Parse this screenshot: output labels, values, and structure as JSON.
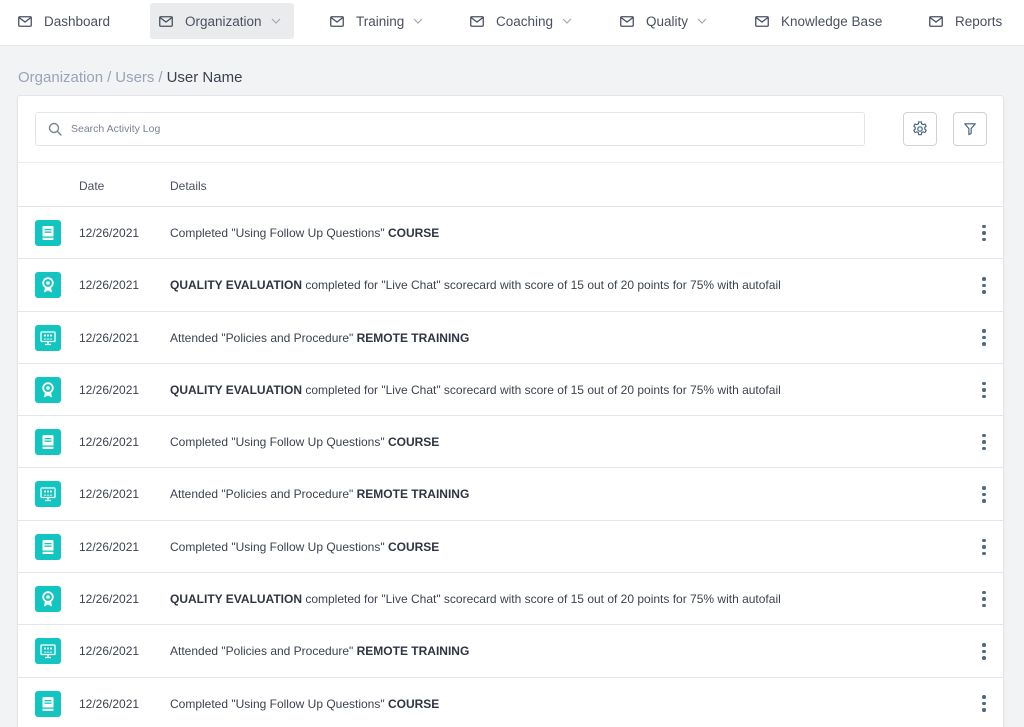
{
  "nav": {
    "items": [
      {
        "label": "Dashboard",
        "dropdown": false,
        "active": false,
        "icon": "mail-icon"
      },
      {
        "label": "Organization",
        "dropdown": true,
        "active": true,
        "icon": "mail-icon"
      },
      {
        "label": "Training",
        "dropdown": true,
        "active": false,
        "icon": "mail-icon"
      },
      {
        "label": "Coaching",
        "dropdown": true,
        "active": false,
        "icon": "mail-icon"
      },
      {
        "label": "Quality",
        "dropdown": true,
        "active": false,
        "icon": "mail-icon"
      },
      {
        "label": "Knowledge Base",
        "dropdown": false,
        "active": false,
        "icon": "mail-icon"
      },
      {
        "label": "Reports",
        "dropdown": false,
        "active": false,
        "icon": "mail-icon"
      }
    ]
  },
  "breadcrumb": {
    "links": [
      "Organization",
      "Users"
    ],
    "separator": "/",
    "current": "User Name"
  },
  "search": {
    "placeholder": "Search Activity Log",
    "value": ""
  },
  "toolbar": {
    "settings_icon": "gear-icon",
    "filter_icon": "filter-icon"
  },
  "table": {
    "columns": [
      "Date",
      "Details"
    ],
    "rows": [
      {
        "type": "course",
        "icon": "book-icon",
        "date": "12/26/2021",
        "pre": "Completed \"Using Follow Up Questions\" ",
        "bold": "COURSE",
        "post": ""
      },
      {
        "type": "quality",
        "icon": "award-icon",
        "date": "12/26/2021",
        "pre": "",
        "bold": "QUALITY EVALUATION",
        "post": " completed for \"Live Chat\" scorecard with score of 15 out of 20 points for 75% with autofail"
      },
      {
        "type": "remote",
        "icon": "presentation-icon",
        "date": "12/26/2021",
        "pre": "Attended \"Policies and Procedure\" ",
        "bold": "REMOTE TRAINING",
        "post": ""
      },
      {
        "type": "quality",
        "icon": "award-icon",
        "date": "12/26/2021",
        "pre": "",
        "bold": "QUALITY EVALUATION",
        "post": " completed for \"Live Chat\" scorecard with score of 15 out of 20 points for 75% with autofail"
      },
      {
        "type": "course",
        "icon": "book-icon",
        "date": "12/26/2021",
        "pre": "Completed \"Using Follow Up Questions\" ",
        "bold": "COURSE",
        "post": ""
      },
      {
        "type": "remote",
        "icon": "presentation-icon",
        "date": "12/26/2021",
        "pre": "Attended \"Policies and Procedure\" ",
        "bold": "REMOTE TRAINING",
        "post": ""
      },
      {
        "type": "course",
        "icon": "book-icon",
        "date": "12/26/2021",
        "pre": "Completed \"Using Follow Up Questions\" ",
        "bold": "COURSE",
        "post": ""
      },
      {
        "type": "quality",
        "icon": "award-icon",
        "date": "12/26/2021",
        "pre": "",
        "bold": "QUALITY EVALUATION",
        "post": " completed for \"Live Chat\" scorecard with score of 15 out of 20 points for 75% with autofail"
      },
      {
        "type": "remote",
        "icon": "presentation-icon",
        "date": "12/26/2021",
        "pre": "Attended \"Policies and Procedure\" ",
        "bold": "REMOTE TRAINING",
        "post": ""
      },
      {
        "type": "course",
        "icon": "book-icon",
        "date": "12/26/2021",
        "pre": "Completed \"Using Follow Up Questions\" ",
        "bold": "COURSE",
        "post": ""
      }
    ]
  },
  "colors": {
    "accent": "#12c5c1",
    "kebab": "#4c6a86",
    "breadcrumb_link": "#9aa3b7",
    "background": "#f2f3f4"
  }
}
